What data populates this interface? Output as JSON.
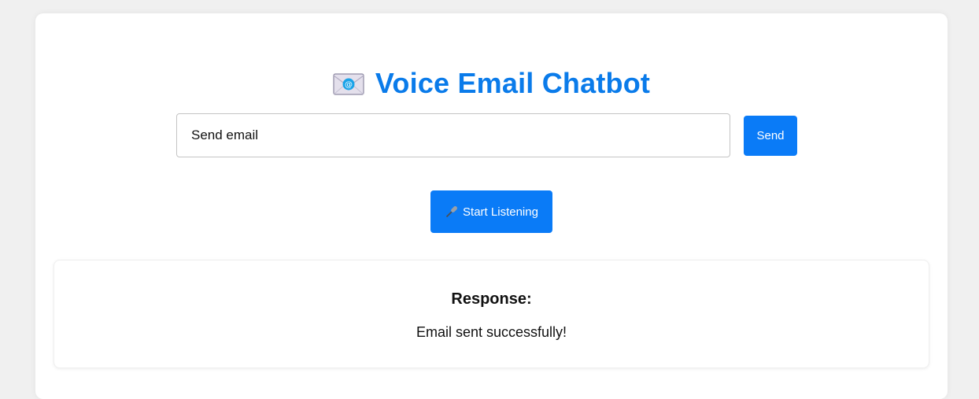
{
  "header": {
    "icon": "incoming-envelope-icon",
    "title": "Voice Email Chatbot"
  },
  "composer": {
    "input_value": "Send email",
    "send_label": "Send"
  },
  "voice": {
    "icon": "microphone-icon",
    "button_label": "Start Listening"
  },
  "response": {
    "heading": "Response:",
    "text": "Email sent successfully!"
  },
  "colors": {
    "accent": "#0a7bf7",
    "title": "#0a7bea",
    "page_background": "#f0f0f0"
  }
}
